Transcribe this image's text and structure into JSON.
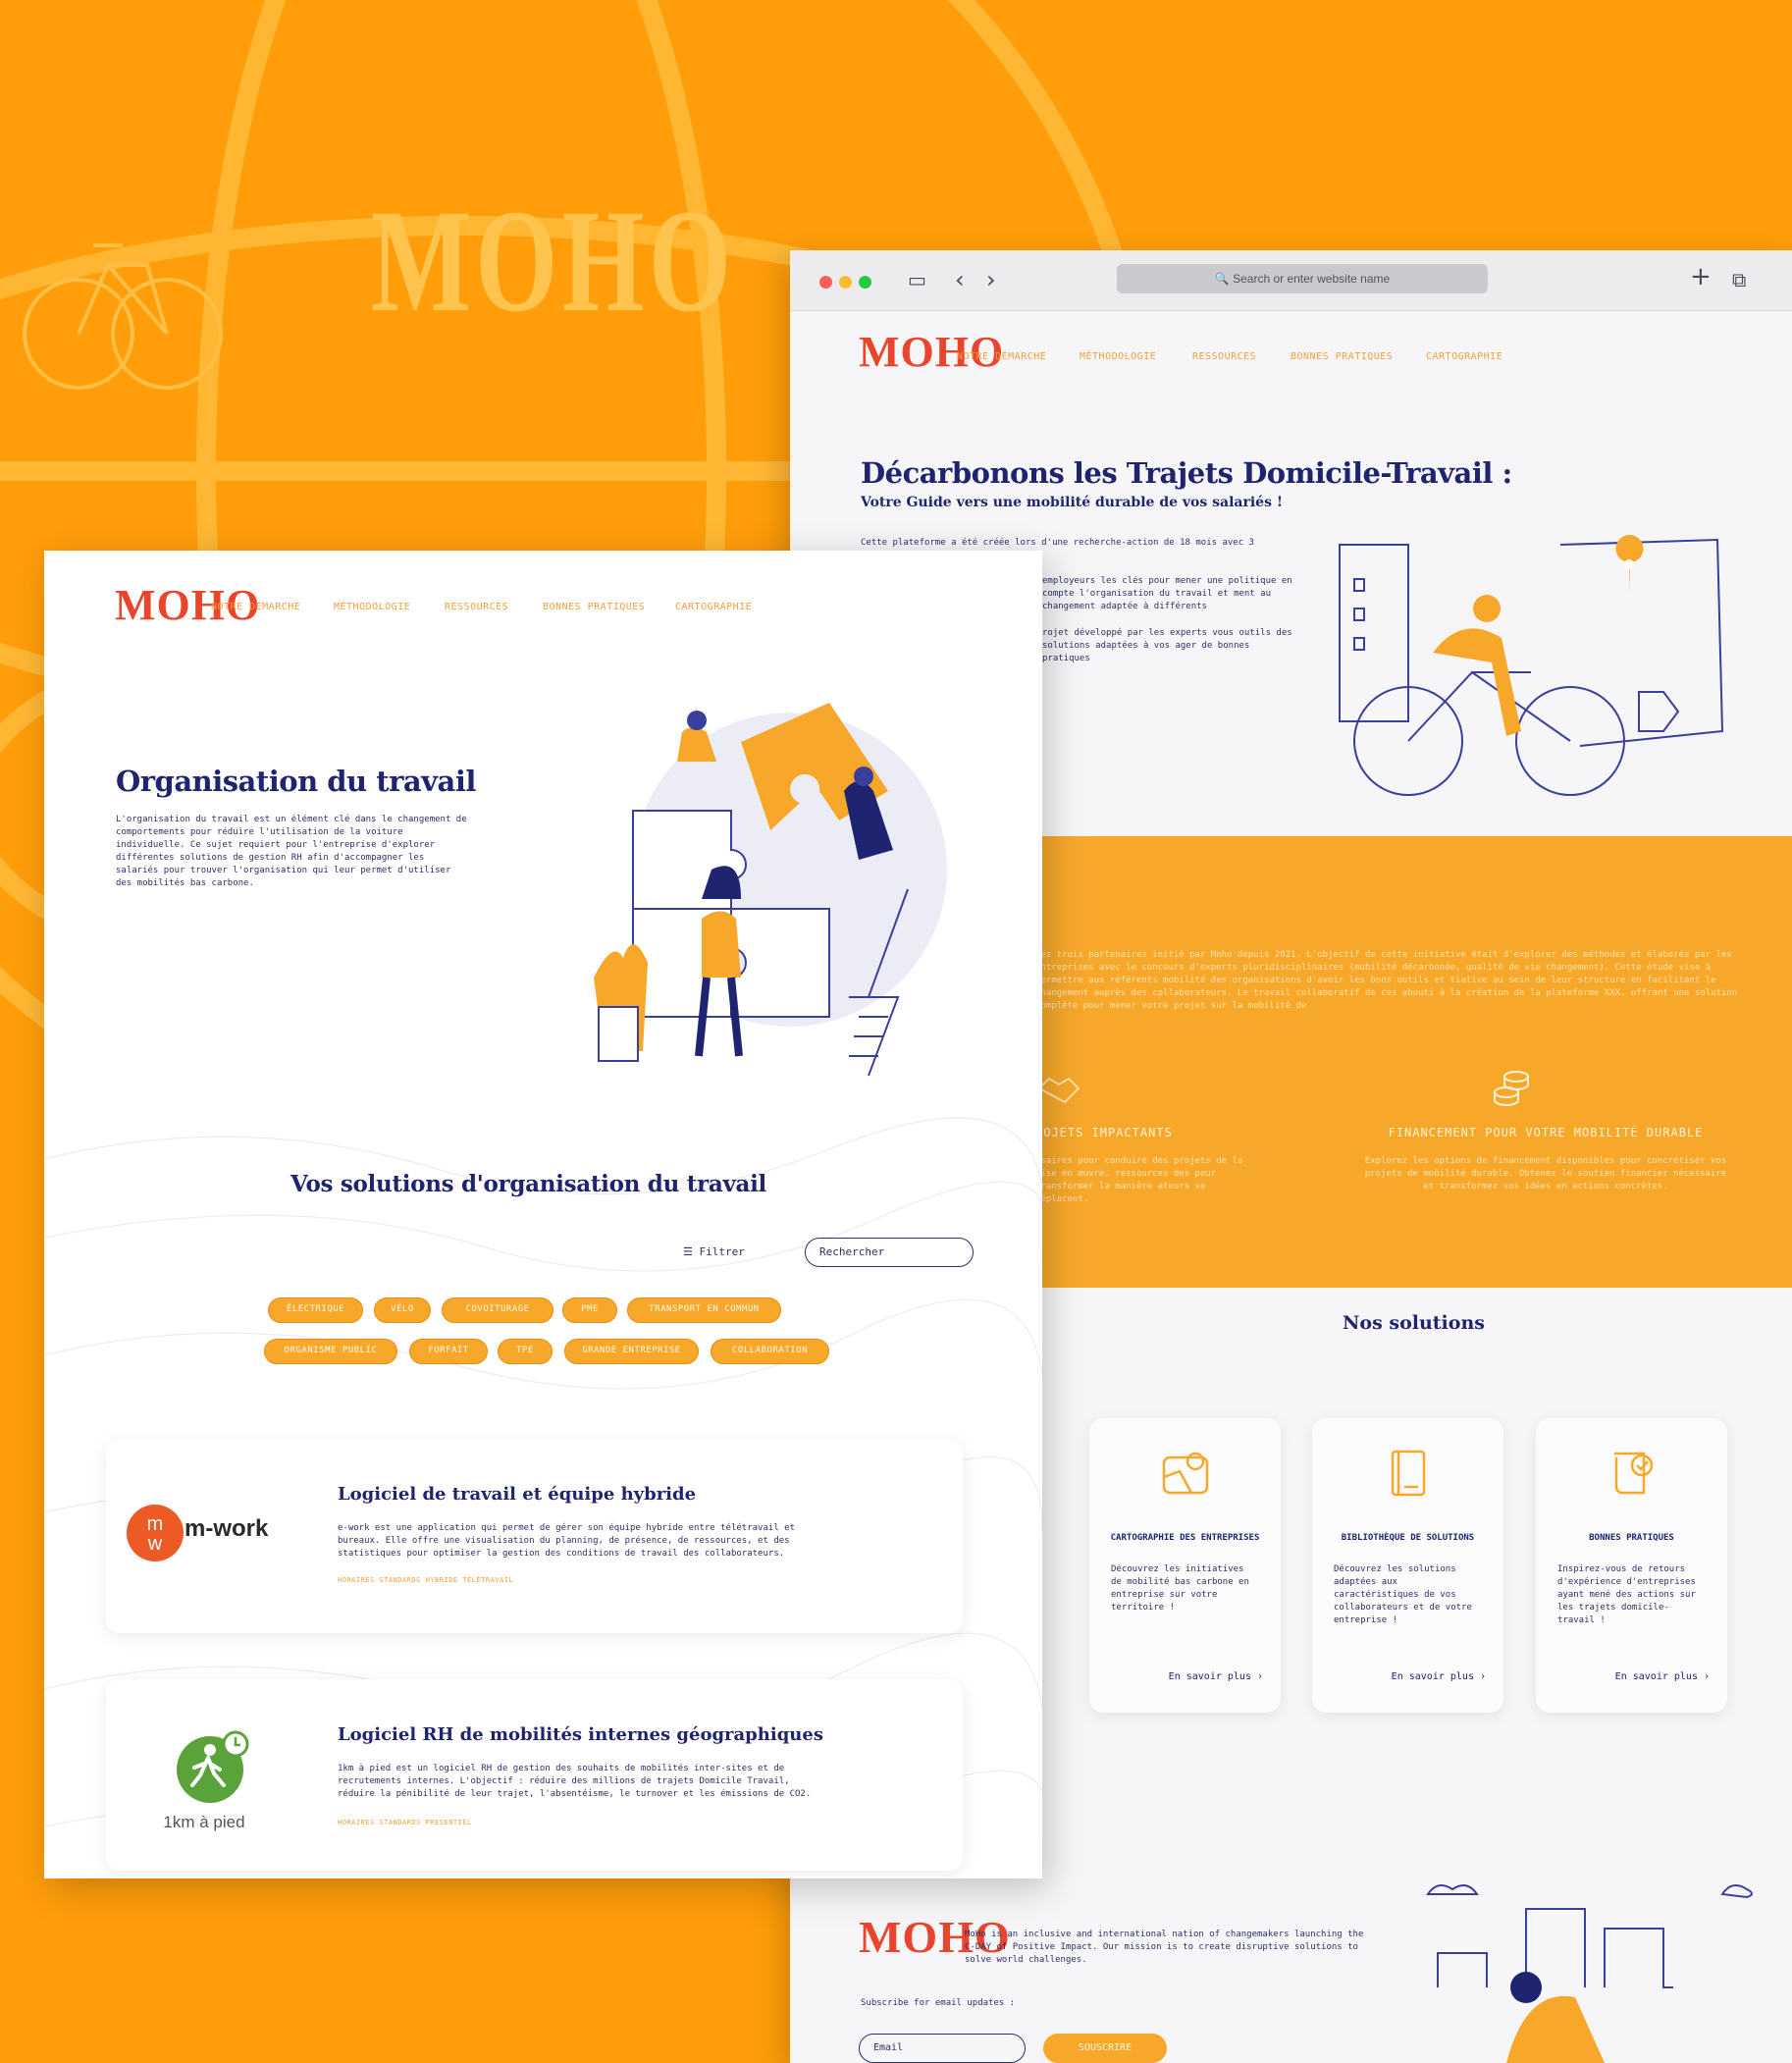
{
  "bg": {
    "logo": "MOHO"
  },
  "browser": {
    "url_placeholder": "Search or enter website name",
    "nav": {
      "logo": "MOHO",
      "links": [
        "NOTRE DÉMARCHE",
        "MÉTHODOLOGIE",
        "RESSOURCES",
        "BONNES PRATIQUES",
        "CARTOGRAPHIE"
      ]
    },
    "hero": {
      "title": "Décarbonons les Trajets Domicile-Travail :",
      "subtitle": "Votre Guide vers une mobilité durable de vos salariés !",
      "p1": "Cette plateforme a été créée lors d'une recherche-action de 18 mois avec 3",
      "p2": "employeurs les clés pour mener une politique en compte l'organisation du travail et ment au changement adaptée à différents",
      "p3": "rojet développé par les experts vous outils des solutions adaptées à vos ager de bonnes pratiques"
    },
    "orange": {
      "text": "ces trois partenaires initié par Moho depuis 2021. L'objectif de cette initiative était d'explorer des méthodes et élaborés par les entreprises avec le concours d'experts pluridisciplinaires (mobilité décarbonée, qualité de vie changement). Cette étude vise à permettre aux référents mobilité des organisations d'avoir les bons outils et tiative au sein de leur structure en facilitant le changement auprès des collaborateurs. Le travail collaboratif de ces abouti à la création de la plateforme XXX, offrant une solution complète pour mener votre projet sur la mobilité de",
      "left_title": "ROJETS IMPACTANTS",
      "left_desc": "ssaires pour conduire des projets de la mise en œuvre, ressources des pour transformer la manière ateurs se déplacent.",
      "right_title": "FINANCEMENT POUR VOTRE MOBILITÉ DURABLE",
      "right_desc": "Explorez les options de financement disponibles pour concrétiser vos projets de mobilité durable. Obtenez le soutien financier nécessaire et transformez vos idées en actions concrètes."
    },
    "solutions": {
      "title": "Nos solutions",
      "cards": [
        {
          "title": "CARTOGRAPHIE DES ENTREPRISES",
          "desc": "Découvrez les initiatives de mobilité bas carbone en entreprise sur votre territoire !",
          "link": "En savoir plus ›"
        },
        {
          "title": "BIBLIOTHÈQUE DE SOLUTIONS",
          "desc": "Découvrez les solutions adaptées aux caractéristiques de vos collaborateurs et de votre entreprise !",
          "link": "En savoir plus ›"
        },
        {
          "title": "BONNES PRATIQUES",
          "desc": "Inspirez-vous de retours d'expérience d'entreprises ayant mené des actions sur les trajets domicile-travail !",
          "link": "En savoir plus ›"
        }
      ]
    },
    "footer": {
      "logo": "MOHO",
      "text": "MoHo is an inclusive and international nation of changemakers launching the C-DAY of Positive Impact. Our mission is to create disruptive solutions to solve world challenges.",
      "subscribe_label": "Subscribe for email updates :",
      "email_placeholder": "Email",
      "subscribe_button": "SOUSCRIRE"
    }
  },
  "page": {
    "nav": {
      "logo": "MOHO",
      "links": [
        "NOTRE DÉMARCHE",
        "MÉTHODOLOGIE",
        "RESSOURCES",
        "BONNES PRATIQUES",
        "CARTOGRAPHIE"
      ]
    },
    "hero": {
      "title": "Organisation du travail",
      "desc": "L'organisation du travail est un élément clé dans le changement de comportements pour réduire l'utilisation de la voiture individuelle. Ce sujet requiert pour l'entreprise d'explorer différentes solutions de gestion RH afin d'accompagner les salariés pour trouver l'organisation qui leur permet d'utiliser des mobilités bas carbone."
    },
    "solutions_title": "Vos solutions d'organisation du travail",
    "filter_label": "Filtrer",
    "search_placeholder": "Rechercher",
    "chips": [
      "ÉLECTRIQUE",
      "VÉLO",
      "COVOITURAGE",
      "PME",
      "TRANSPORT EN COMMUN",
      "ORGANISME PUBLIC",
      "FORFAIT",
      "TPE",
      "GRANDE ENTREPRISE",
      "COLLABORATION"
    ],
    "cards": [
      {
        "logo_text": "m-work",
        "title": "Logiciel de travail et équipe hybride",
        "desc": "e-work est une application qui permet de gérer son équipe hybride entre télétravail et bureaux. Elle offre une visualisation du planning, de présence, de ressources, et des statistiques pour optimiser la gestion des conditions de travail des collaborateurs.",
        "tags": "HORAIRES STANDARDS   HYBRIDE   TÉLÉTRAVAIL"
      },
      {
        "logo_text": "1km à pied",
        "title": "Logiciel RH de mobilités internes géographiques",
        "desc": "1km à pied est un logiciel RH de gestion des souhaits de mobilités inter-sites et de recrutements internes. L'objectif : réduire des millions de trajets Domicile Travail, réduire la pénibilité de leur trajet, l'absentéisme, le turnover et les émissions de CO2.",
        "tags": "HORAIRES STANDARDS   PRESENTIEL"
      }
    ]
  },
  "colors": {
    "navy": "#1e2470",
    "orange": "#f7a82b",
    "bg_orange": "#ff9d0a",
    "logo_red": "#e8452c"
  }
}
